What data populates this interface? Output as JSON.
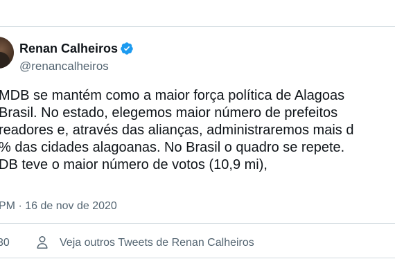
{
  "author": {
    "display_name": "Renan Calheiros",
    "handle": "@renancalheiros",
    "verified_icon": "verified-badge-icon",
    "verified_color": "#1d9bf0"
  },
  "tweet": {
    "lines": [
      "MDB se mantém como a maior força política de Alagoas",
      "Brasil. No estado, elegemos maior número de prefeitos",
      "readores e, através das alianças, administraremos mais d",
      "% das cidades alagoanas. No Brasil o quadro se repete.",
      "DB teve o maior número de votos (10,9 mi),"
    ],
    "timestamp": "PM · 16 de nov de 2020"
  },
  "footer": {
    "like_count": "30",
    "more_tweets_label": "Veja outros Tweets de Renan Calheiros",
    "person_icon": "person-icon"
  },
  "colors": {
    "text_primary": "#0f1419",
    "text_secondary": "#536471",
    "border": "#cfd9de"
  }
}
